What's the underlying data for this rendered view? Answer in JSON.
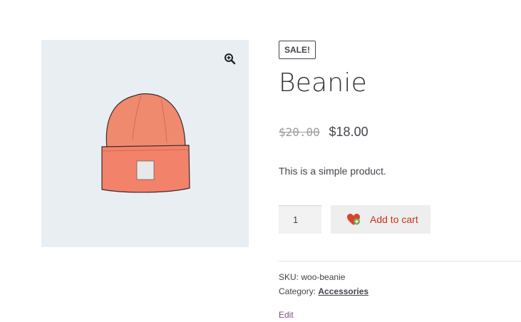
{
  "gallery": {
    "zoom_icon": "magnifier-plus-icon",
    "image_alt": "Beanie"
  },
  "product": {
    "sale_badge": "SALE!",
    "title": "Beanie",
    "old_price": "$20.00",
    "new_price": "$18.00",
    "short_description": "This is a simple product."
  },
  "cart": {
    "quantity": "1",
    "add_to_cart_label": "Add to cart",
    "button_icon": "heart-plus-icon"
  },
  "meta": {
    "sku_label": "SKU:",
    "sku_value": "woo-beanie",
    "category_label": "Category:",
    "category_value": "Accessories"
  },
  "edit_link": "Edit",
  "colors": {
    "gallery_bg": "#e9eef2",
    "beanie": "#f28a6d",
    "button_text": "#c9341c",
    "edit_link": "#7c4a7f"
  }
}
